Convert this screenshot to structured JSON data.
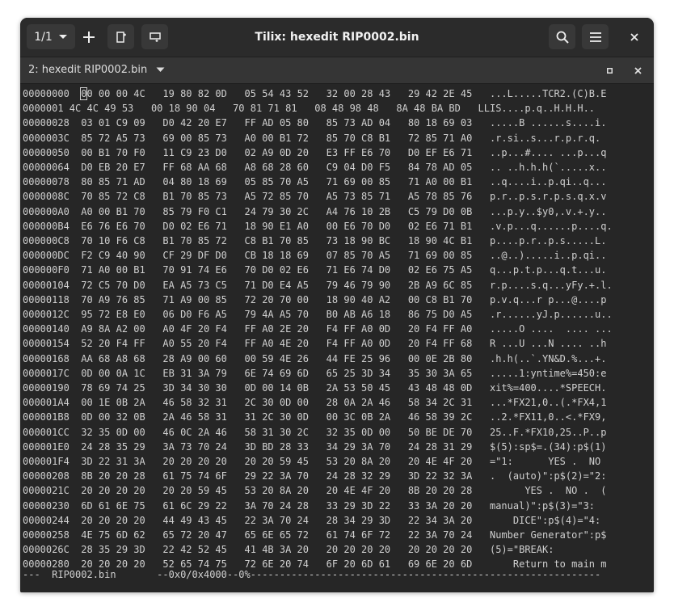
{
  "window": {
    "title": "Tilix: hexedit RIP0002.bin",
    "session_label": "1/1",
    "tab_title": "2: hexedit RIP0002.bin"
  },
  "icons": {
    "session_dropdown": "chevron-down-icon",
    "add_terminal": "plus-icon",
    "split_right": "split-right-icon",
    "split_down": "split-down-icon",
    "search": "search-icon",
    "menu": "hamburger-menu-icon",
    "close_window": "close-icon",
    "tab_dropdown": "chevron-down-icon",
    "maximize_terminal": "maximize-icon",
    "close_terminal": "close-icon"
  },
  "colors": {
    "titlebar_bg": "#2b2b2b",
    "terminal_bg": "#262626",
    "terminal_fg": "#d0d0d0"
  },
  "hexdump": {
    "first_row_rest": "0 00 00 4C   19 80 82 0D   05 54 43 52   32 00 28 43   29 42 2E 45   ...L.....TCR2.(C)B.E",
    "rows": [
      "0000001 4C 4C 49 53   00 18 90 04   70 81 71 81   08 48 98 48   8A 48 BA BD   LLIS....p.q..H.H.H..",
      "00000028  03 01 C9 09   D0 42 20 E7   FF AD 05 80   85 73 AD 04   80 18 69 03   .....B ......s....i.",
      "0000003C  85 72 A5 73   69 00 85 73   A0 00 B1 72   85 70 C8 B1   72 85 71 A0   .r.si..s...r.p.r.q.",
      "00000050  00 B1 70 F0   11 C9 23 D0   02 A9 0D 20   E3 FF E6 70   D0 EF E6 71   ..p...#.... ...p...q",
      "00000064  D0 EB 20 E7   FF 68 AA 68   A8 68 28 60   C9 04 D0 F5   84 78 AD 05   .. ..h.h.h(`.....x..",
      "00000078  80 85 71 AD   04 80 18 69   05 85 70 A5   71 69 00 85   71 A0 00 B1   ..q....i..p.qi..q...",
      "0000008C  70 85 72 C8   B1 70 85 73   A5 72 85 70   A5 73 85 71   A5 78 85 76   p.r..p.s.r.p.s.q.x.v",
      "000000A0  A0 00 B1 70   85 79 F0 C1   24 79 30 2C   A4 76 10 2B   C5 79 D0 0B   ...p.y..$y0,.v.+.y..",
      "000000B4  E6 76 E6 70   D0 02 E6 71   18 90 E1 A0   00 E6 70 D0   02 E6 71 B1   .v.p...q......p....q.",
      "000000C8  70 10 F6 C8   B1 70 85 72   C8 B1 70 85   73 18 90 BC   18 90 4C B1   p....p.r..p.s.....L.",
      "000000DC  F2 C9 40 90   CF 29 DF D0   CB 18 18 69   07 85 70 A5   71 69 00 85   ..@..).....i..p.qi..",
      "000000F0  71 A0 00 B1   70 91 74 E6   70 D0 02 E6   71 E6 74 D0   02 E6 75 A5   q...p.t.p...q.t...u.",
      "00000104  72 C5 70 D0   EA A5 73 C5   71 D0 E4 A5   79 46 79 90   2B A9 6C 85   r.p....s.q...yFy.+.l.",
      "00000118  70 A9 76 85   71 A9 00 85   72 20 70 00   18 90 40 A2   00 C8 B1 70   p.v.q...r p...@....p",
      "0000012C  95 72 E8 E0   06 D0 F6 A5   79 4A A5 70   B0 AB A6 18   86 75 D0 A5   .r......yJ.p......u..",
      "00000140  A9 8A A2 00   A0 4F 20 F4   FF A0 2E 20   F4 FF A0 0D   20 F4 FF A0   .....O ....  .... ...",
      "00000154  52 20 F4 FF   A0 55 20 F4   FF A0 4E 20   F4 FF A0 0D   20 F4 FF 68   R ...U ...N .... ..h",
      "00000168  AA 68 A8 68   28 A9 00 60   00 59 4E 26   44 FE 25 96   00 0E 2B 80   .h.h(..`.YN&D.%...+.",
      "0000017C  0D 00 0A 1C   EB 31 3A 79   6E 74 69 6D   65 25 3D 34   35 30 3A 65   .....1:yntime%=450:e",
      "00000190  78 69 74 25   3D 34 30 30   0D 00 14 0B   2A 53 50 45   43 48 48 0D   xit%=400....*SPEECH.",
      "000001A4  00 1E 0B 2A   46 58 32 31   2C 30 0D 00   28 0A 2A 46   58 34 2C 31   ...*FX21,0..(.*FX4,1",
      "000001B8  0D 00 32 0B   2A 46 58 31   31 2C 30 0D   00 3C 0B 2A   46 58 39 2C   ..2.*FX11,0..<.*FX9,",
      "000001CC  32 35 0D 00   46 0C 2A 46   58 31 30 2C   32 35 0D 00   50 BE DE 70   25..F.*FX10,25..P..p",
      "000001E0  24 28 35 29   3A 73 70 24   3D BD 28 33   34 29 3A 70   24 28 31 29   $(5):sp$=.(34):p$(1)",
      "000001F4  3D 22 31 3A   20 20 20 20   20 20 59 45   53 20 8A 20   20 4E 4F 20   =\"1:      YES .  NO ",
      "00000208  8B 20 20 28   61 75 74 6F   29 22 3A 70   24 28 32 29   3D 22 32 3A   .  (auto)\":p$(2)=\"2:",
      "0000021C  20 20 20 20   20 20 59 45   53 20 8A 20   20 4E 4F 20   8B 20 20 28         YES .  NO .  (",
      "00000230  6D 61 6E 75   61 6C 29 22   3A 70 24 28   33 29 3D 22   33 3A 20 20   manual)\":p$(3)=\"3:  ",
      "00000244  20 20 20 20   44 49 43 45   22 3A 70 24   28 34 29 3D   22 34 3A 20       DICE\":p$(4)=\"4: ",
      "00000258  4E 75 6D 62   65 72 20 47   65 6E 65 72   61 74 6F 72   22 3A 70 24   Number Generator\":p$",
      "0000026C  28 35 29 3D   22 42 52 45   41 4B 3A 20   20 20 20 20   20 20 20 20   (5)=\"BREAK:         ",
      "00000280  20 20 20 20   52 65 74 75   72 6E 20 74   6F 20 6D 61   69 6E 20 6D       Return to main m"
    ],
    "status_line": "---  RIP0002.bin       --0x0/0x4000--0%------------------------------------------------------------"
  }
}
